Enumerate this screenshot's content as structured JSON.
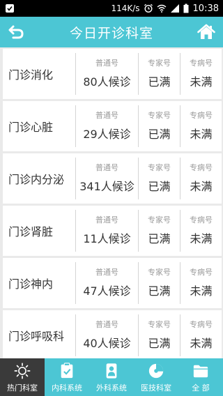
{
  "status_bar": {
    "speed": "114K/s",
    "time": "10:38"
  },
  "header": {
    "title": "今日开诊科室"
  },
  "labels": {
    "normal": "普通号",
    "expert": "专家号",
    "special": "专病号"
  },
  "departments": [
    {
      "name": "门诊消化",
      "normal": "80人候诊",
      "expert": "已满",
      "special": "未满"
    },
    {
      "name": "门诊心脏",
      "normal": "29人候诊",
      "expert": "已满",
      "special": "未满"
    },
    {
      "name": "门诊内分泌",
      "normal": "341人候诊",
      "expert": "已满",
      "special": "未满"
    },
    {
      "name": "门诊肾脏",
      "normal": "11人候诊",
      "expert": "已满",
      "special": "未满"
    },
    {
      "name": "门诊神内",
      "normal": "47人候诊",
      "expert": "已满",
      "special": "未满"
    },
    {
      "name": "门诊呼吸科",
      "normal": "40人候诊",
      "expert": "已满",
      "special": "未满"
    }
  ],
  "tabs": [
    {
      "label": "热门科室",
      "icon": "sun-icon",
      "active": true
    },
    {
      "label": "内科系统",
      "icon": "clipboard-icon",
      "active": false
    },
    {
      "label": "外科系统",
      "icon": "person-icon",
      "active": false
    },
    {
      "label": "医技科室",
      "icon": "chart-icon",
      "active": false
    },
    {
      "label": "全 部",
      "icon": "folder-icon",
      "active": false
    }
  ],
  "colors": {
    "accent": "#4cc6d4",
    "active_tab": "#3a3a3a"
  }
}
